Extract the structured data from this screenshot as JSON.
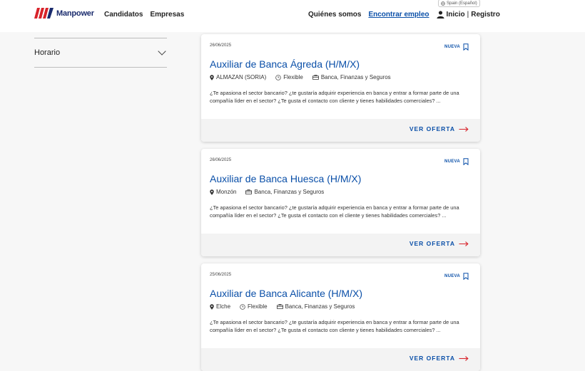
{
  "header": {
    "logo_text": "Manpower",
    "nav_left": [
      "Candidatos",
      "Empresas"
    ],
    "language": "Spain (Español)",
    "nav_right": [
      "Quiénes somos",
      "Encontrar empleo"
    ],
    "login": "Inicio",
    "separator": "|",
    "register": "Registro"
  },
  "sidebar": {
    "filters": [
      {
        "label": "Horario"
      }
    ]
  },
  "jobs": [
    {
      "date": "26/06/2025",
      "badge": "NUEVA",
      "title": "Auxiliar de Banca Ágreda (H/M/X)",
      "location": "ALMAZAN (SORIA)",
      "schedule": "Flexible",
      "sector": "Banca, Finanzas y Seguros",
      "description": "¿Te apasiona el sector bancario? ¿te gustaría adquirir experiencia en banca y entrar a formar parte de una compañía líder en el sector? ¿Te gusta el contacto con cliente y tienes habilidades comerciales? ...",
      "cta": "VER OFERTA"
    },
    {
      "date": "26/06/2025",
      "badge": "NUEVA",
      "title": "Auxiliar de Banca Huesca (H/M/X)",
      "location": "Monzón",
      "schedule": "",
      "sector": "Banca, Finanzas y Seguros",
      "description": "¿Te apasiona el sector bancario? ¿te gustaría adquirir experiencia en banca y entrar a formar parte de una compañía líder en el sector? ¿Te gusta el contacto con el cliente y tienes habilidades comerciales? ...",
      "cta": "VER OFERTA"
    },
    {
      "date": "25/06/2025",
      "badge": "NUEVA",
      "title": "Auxiliar de Banca Alicante (H/M/X)",
      "location": "Elche",
      "schedule": "Flexible",
      "sector": "Banca, Finanzas y Seguros",
      "description": "¿Te apasiona el sector bancario? ¿te gustaría adquirir experiencia en banca y entrar a formar parte de una compañía líder en el sector? ¿Te gusta el contacto con cliente y tienes habilidades comerciales? ...",
      "cta": "VER OFERTA"
    }
  ],
  "colors": {
    "accent": "#0a4fa8",
    "brand_red": "#d8232a",
    "brand_navy": "#1a2b6d"
  },
  "icons": {
    "logo": "manpower-logo-icon",
    "user": "person-icon",
    "globe": "globe-icon",
    "chevron": "chevron-down-icon",
    "bookmark": "bookmark-icon",
    "location": "map-pin-icon",
    "schedule": "clock-icon",
    "sector": "briefcase-icon",
    "cta": "arrow-right-icon"
  }
}
